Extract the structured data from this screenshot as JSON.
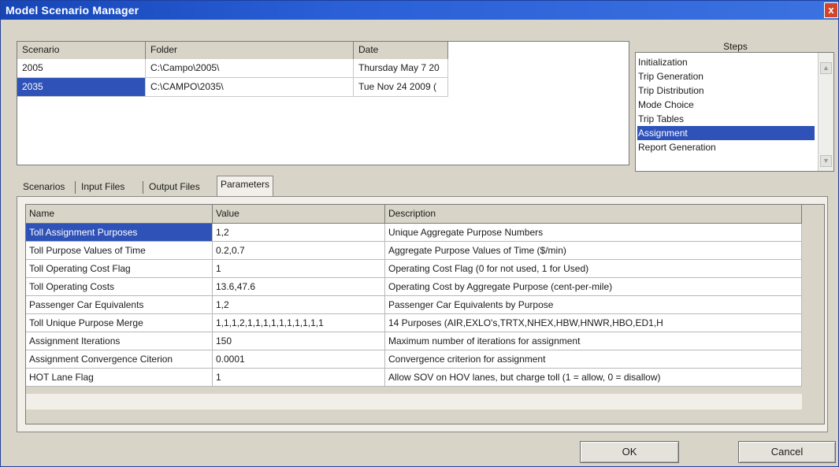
{
  "window": {
    "title": "Model Scenario Manager",
    "close_glyph": "x"
  },
  "scenarios": {
    "headers": [
      "Scenario",
      "Folder",
      "Date"
    ],
    "rows": [
      {
        "scenario": "2005",
        "folder": "C:\\Campo\\2005\\",
        "date": "Thursday May 7 20"
      },
      {
        "scenario": "2035",
        "folder": "C:\\CAMPO\\2035\\",
        "date": "Tue Nov 24 2009 ("
      }
    ],
    "selected_row": 1
  },
  "steps": {
    "label": "Steps",
    "items": [
      "Initialization",
      "Trip Generation",
      "Trip Distribution",
      "Mode Choice",
      "Trip Tables",
      "Assignment",
      "Report Generation"
    ],
    "selected": "Assignment"
  },
  "tabs": {
    "items": [
      "Scenarios",
      "Input Files",
      "Output Files",
      "Parameters"
    ],
    "active": "Parameters"
  },
  "parameters": {
    "headers": [
      "Name",
      "Value",
      "Description"
    ],
    "rows": [
      {
        "name": "Toll Assignment Purposes",
        "value": "1,2",
        "description": "Unique Aggregate Purpose Numbers"
      },
      {
        "name": "Toll Purpose Values of Time",
        "value": "0.2,0.7",
        "description": "Aggregate Purpose Values of Time ($/min)"
      },
      {
        "name": "Toll Operating Cost Flag",
        "value": "1",
        "description": "Operating Cost Flag (0 for not used, 1 for Used)"
      },
      {
        "name": "Toll Operating Costs",
        "value": "13.6,47.6",
        "description": "Operating Cost by Aggregate Purpose (cent-per-mile)"
      },
      {
        "name": "Passenger Car Equivalents",
        "value": "1,2",
        "description": "Passenger Car Equivalents by Purpose"
      },
      {
        "name": "Toll Unique Purpose Merge",
        "value": "1,1,1,2,1,1,1,1,1,1,1,1,1,1",
        "description": "14 Purposes (AIR,EXLO's,TRTX,NHEX,HBW,HNWR,HBO,ED1,H"
      },
      {
        "name": "Assignment Iterations",
        "value": "150",
        "description": "Maximum number of iterations for assignment"
      },
      {
        "name": "Assignment Convergence Citerion",
        "value": "0.0001",
        "description": "Convergence criterion for assignment"
      },
      {
        "name": "HOT Lane Flag",
        "value": "1",
        "description": "Allow SOV on HOV lanes, but charge toll (1 = allow, 0 = disallow)"
      }
    ],
    "selected_row": 0
  },
  "buttons": {
    "ok": "OK",
    "cancel": "Cancel"
  },
  "colors": {
    "title_bar": "#2a5fd6",
    "selection": "#2f52b8",
    "close": "#d2452a"
  }
}
